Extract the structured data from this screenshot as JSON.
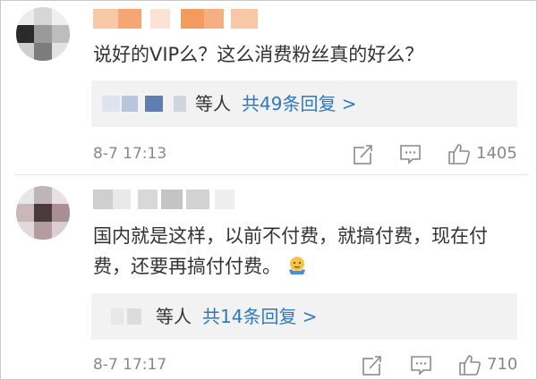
{
  "comments": [
    {
      "text": "说好的VIP么？这么消费粉丝真的好么？",
      "replies": {
        "who": "等人",
        "more": "共49条回复 >"
      },
      "time": "8-7 17:13",
      "likes": "1405"
    },
    {
      "text": "国内就是这样，以前不付费，就搞付费，现在付费，还要再搞付付费。",
      "emoji": "shrug-emoji",
      "replies": {
        "who": "等人",
        "more": "共14条回复 >"
      },
      "time": "8-7 17:17",
      "likes": "710"
    }
  ],
  "icons": {
    "share": "share-icon",
    "comment": "comment-icon",
    "like": "thumbs-up-icon"
  },
  "colors": {
    "link": "#2f78c0",
    "meta": "#888888",
    "reply_bg": "#f2f2f2"
  }
}
